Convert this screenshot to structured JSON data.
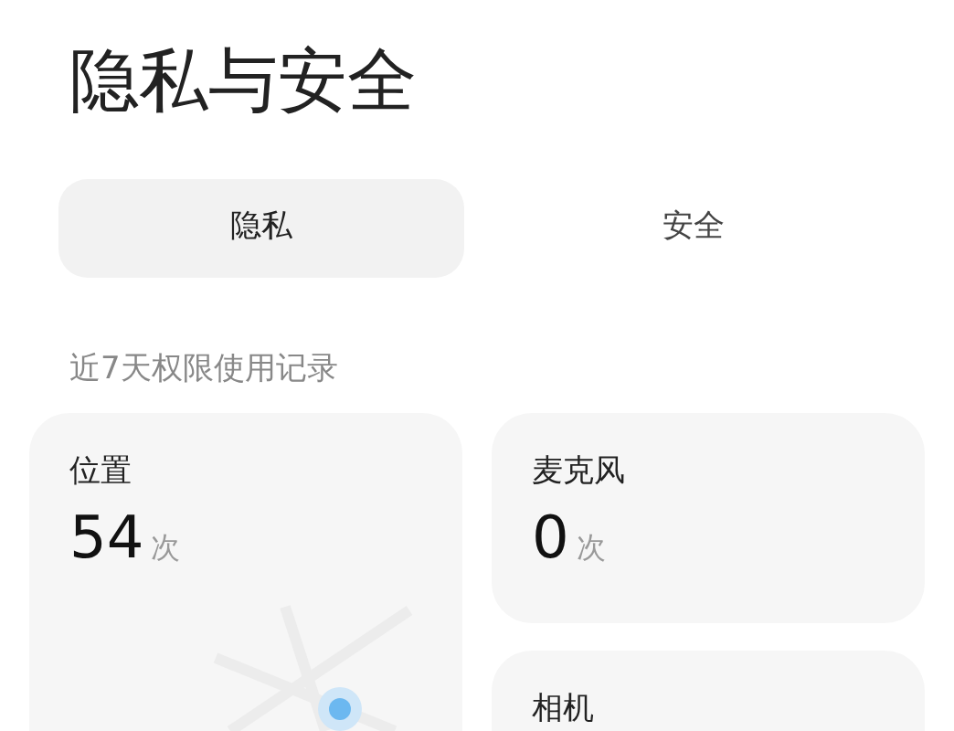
{
  "title": "隐私与安全",
  "tabs": [
    {
      "label": "隐私",
      "selected": true
    },
    {
      "label": "安全",
      "selected": false
    }
  ],
  "section_label": "近7天权限使用记录",
  "cards": [
    {
      "kind": "map",
      "name": "位置",
      "count": "54",
      "unit": "次"
    },
    {
      "kind": "plain",
      "name": "麦克风",
      "count": "0",
      "unit": "次"
    },
    {
      "kind": "plain",
      "name": "相机"
    }
  ]
}
